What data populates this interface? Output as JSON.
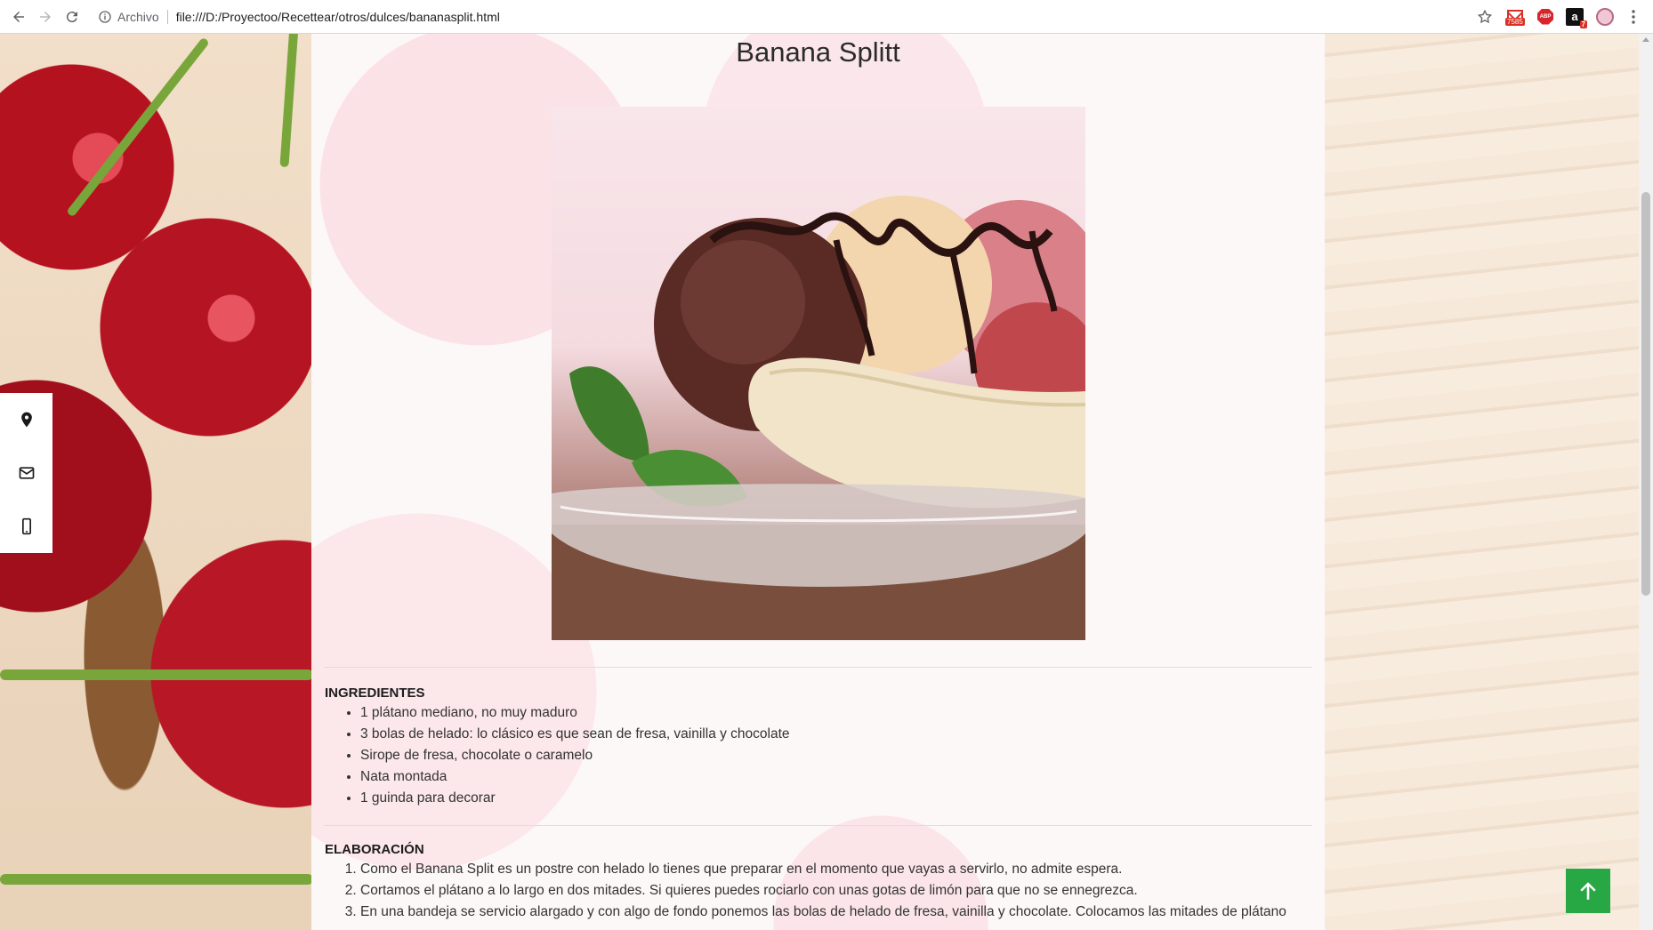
{
  "browser": {
    "security_label": "Archivo",
    "url": "file:///D:/Proyectoo/Recettear/otros/dulces/bananasplit.html",
    "gmail_count": "7585",
    "abp_label": "ABP",
    "amazon_label": "a",
    "amazon_count": "7"
  },
  "recipe": {
    "title": "Banana Splitt",
    "ingredients_heading": "INGREDIENTES",
    "ingredients": [
      "1 plátano mediano, no muy maduro",
      "3 bolas de helado: lo clásico es que sean de fresa, vainilla y chocolate",
      "Sirope de fresa, chocolate o caramelo",
      "Nata montada",
      "1 guinda para decorar"
    ],
    "steps_heading": "ELABORACIÓN",
    "steps": [
      "Como el Banana Split es un postre con helado lo tienes que preparar en el momento que vayas a servirlo, no admite espera.",
      "Cortamos el plátano a lo largo en dos mitades. Si quieres puedes rociarlo con unas gotas de limón para que no se ennegrezca.",
      "En una bandeja se servicio alargado y con algo de fondo ponemos las bolas de helado de fresa, vainilla y chocolate. Colocamos las mitades de plátano"
    ]
  },
  "icons": {
    "social": [
      "map-marker-icon",
      "envelope-icon",
      "mobile-phone-icon"
    ],
    "scroll_top": "arrow-up-icon"
  },
  "colors": {
    "scroll_top_bg": "#28a745",
    "social_bar_bg": "#ffffff"
  }
}
